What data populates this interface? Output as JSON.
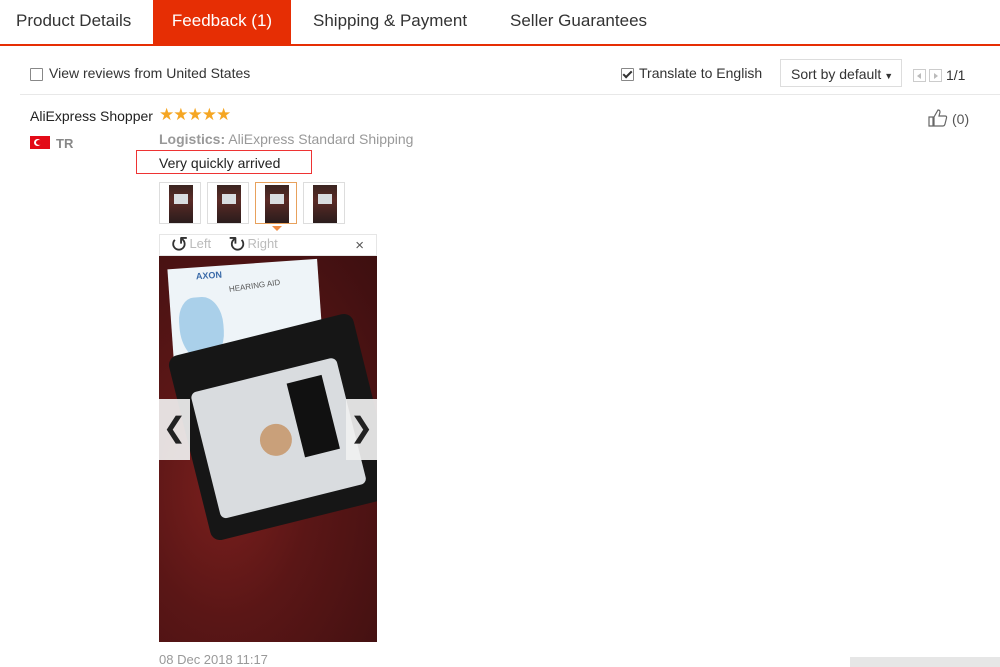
{
  "tabs": [
    {
      "label": "Product Details",
      "active": false
    },
    {
      "label": "Feedback (1)",
      "active": true
    },
    {
      "label": "Shipping & Payment",
      "active": false
    },
    {
      "label": "Seller Guarantees",
      "active": false
    }
  ],
  "filter": {
    "us_label": "View reviews from United States",
    "us_checked": false,
    "translate_label": "Translate to English",
    "translate_checked": true,
    "sort_label": "Sort by default",
    "page": "1/1"
  },
  "review": {
    "user": "AliExpress Shopper",
    "country": "TR",
    "stars": "★★★★★",
    "rating": 5,
    "logistics_label": "Logistics:",
    "logistics_value": "AliExpress Standard Shipping",
    "comment": "Very quickly arrived",
    "date": "08 Dec 2018 11:17",
    "likes": "(0)"
  },
  "viewer": {
    "rotate_left": "Left",
    "rotate_right": "Right",
    "close": "×",
    "photo_brand": "AXON",
    "photo_text": "HEARING AID"
  },
  "colors": {
    "accent": "#e62e04",
    "star": "#f5a623",
    "muted": "#999999"
  }
}
